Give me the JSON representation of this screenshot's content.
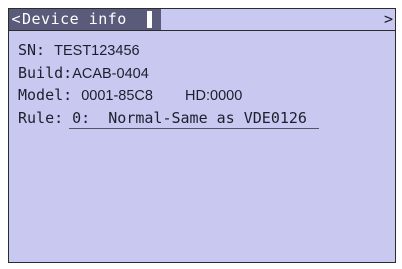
{
  "header": {
    "back_glyph": "<",
    "title": "Device info",
    "forward_glyph": ">"
  },
  "info": {
    "sn_label": "SN:",
    "sn_value": "TEST123456",
    "build_label": "Build:",
    "build_value": "ACAB-0404",
    "model_label": "Model:",
    "model_value": "0001-85C8",
    "hd_label": "HD:",
    "hd_value": "0000",
    "rule_label": "Rule:",
    "rule_value": "0:  Normal-Same as VDE0126"
  },
  "colors": {
    "screen_bg": "#c8c8f0",
    "title_bg": "#5a5a7a",
    "text": "#1e1e2e"
  }
}
